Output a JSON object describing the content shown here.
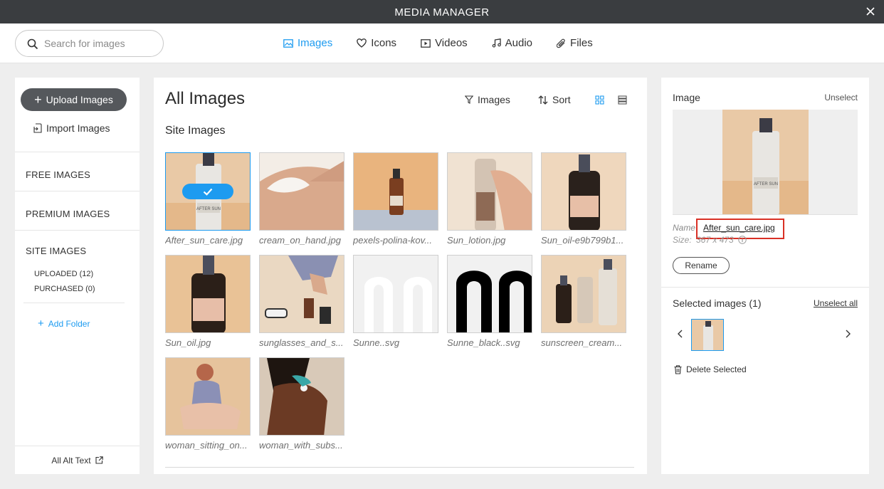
{
  "window": {
    "title": "MEDIA MANAGER",
    "close_icon": "close-icon"
  },
  "search": {
    "placeholder": "Search for images"
  },
  "tabs": [
    {
      "label": "Images",
      "icon": "image-icon",
      "active": true
    },
    {
      "label": "Icons",
      "icon": "heart-icon",
      "active": false
    },
    {
      "label": "Videos",
      "icon": "play-icon",
      "active": false
    },
    {
      "label": "Audio",
      "icon": "music-icon",
      "active": false
    },
    {
      "label": "Files",
      "icon": "paperclip-icon",
      "active": false
    }
  ],
  "sidebar": {
    "upload_label": "Upload Images",
    "import_label": "Import Images",
    "free_images": "FREE IMAGES",
    "premium_images": "PREMIUM IMAGES",
    "site_images": "SITE IMAGES",
    "uploaded": "UPLOADED (12)",
    "purchased": "PURCHASED (0)",
    "add_folder": "Add Folder",
    "alt_text": "All Alt Text"
  },
  "main": {
    "title": "All Images",
    "filter_label": "Images",
    "sort_label": "Sort",
    "section_title": "Site Images",
    "images": [
      {
        "caption": "After_sun_care.jpg",
        "selected": true
      },
      {
        "caption": "cream_on_hand.jpg",
        "selected": false
      },
      {
        "caption": "pexels-polina-kov...",
        "selected": false
      },
      {
        "caption": "Sun_lotion.jpg",
        "selected": false
      },
      {
        "caption": "Sun_oil-e9b799b1...",
        "selected": false
      },
      {
        "caption": "Sun_oil.jpg",
        "selected": false
      },
      {
        "caption": "sunglasses_and_s...",
        "selected": false
      },
      {
        "caption": "Sunne..svg",
        "selected": false
      },
      {
        "caption": "Sunne_black..svg",
        "selected": false
      },
      {
        "caption": "sunscreen_cream...",
        "selected": false
      },
      {
        "caption": "woman_sitting_on...",
        "selected": false
      },
      {
        "caption": "woman_with_subs...",
        "selected": false
      }
    ]
  },
  "details": {
    "label": "Image",
    "unselect": "Unselect",
    "name_label": "Name",
    "name_value": "After_sun_care.jpg",
    "size_label": "Size:",
    "size_value": "367 x 473",
    "rename": "Rename",
    "selected_title": "Selected images (1)",
    "unselect_all": "Unselect all",
    "delete_selected": "Delete Selected"
  },
  "colors": {
    "accent": "#1d9bf0",
    "titlebar": "#3a3d40",
    "highlight_box": "#d93025"
  }
}
